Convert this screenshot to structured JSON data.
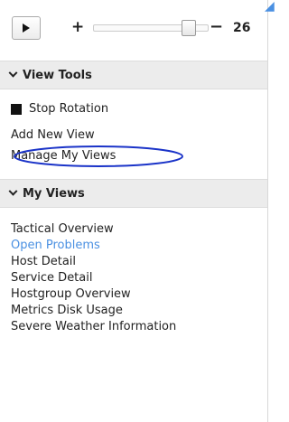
{
  "controls": {
    "play_icon": "play-icon",
    "plus_label": "+",
    "minus_label": "−",
    "slider_level": 0.83,
    "slider_value": "26"
  },
  "view_tools": {
    "title": "View Tools",
    "stop_rotation": "Stop Rotation",
    "add_new_view": "Add New View",
    "manage_my_views": "Manage My Views"
  },
  "my_views": {
    "title": "My Views",
    "items": [
      {
        "label": "Tactical Overview",
        "active": false
      },
      {
        "label": "Open Problems",
        "active": true
      },
      {
        "label": "Host Detail",
        "active": false
      },
      {
        "label": "Service Detail",
        "active": false
      },
      {
        "label": "Hostgroup Overview",
        "active": false
      },
      {
        "label": "Metrics Disk Usage",
        "active": false
      },
      {
        "label": "Severe Weather Information",
        "active": false
      }
    ]
  },
  "colors": {
    "active_link": "#4a90e2",
    "header_bg": "#ececec",
    "annotation": "#1a33c8"
  }
}
